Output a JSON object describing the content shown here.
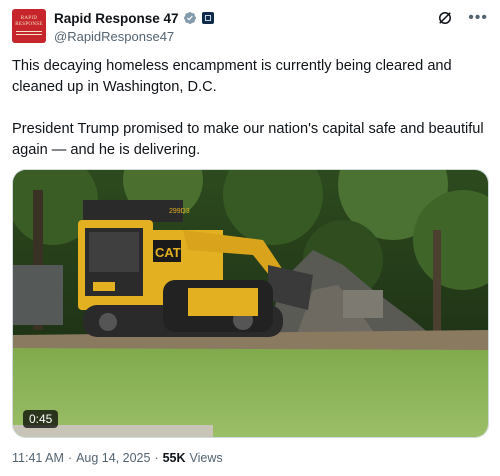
{
  "header": {
    "display_name": "Rapid Response 47",
    "handle": "@RapidResponse47",
    "avatar_text": [
      "RAPID",
      "RESPONSE"
    ],
    "icons": [
      "verified-badge-icon",
      "government-affiliation-icon",
      "grok-icon",
      "more-options-icon"
    ]
  },
  "tweet": {
    "paragraph1": "This decaying homeless encampment is currently being cleared and cleaned up in Washington, D.C.",
    "paragraph2": "President Trump promised to make our nation's capital safe and beautiful again — and he is delivering."
  },
  "media": {
    "duration": "0:45",
    "vehicle_brand": "CAT",
    "vehicle_model": "299D3"
  },
  "meta": {
    "time": "11:41 AM",
    "sep1": "·",
    "date": "Aug 14, 2025",
    "sep2": "·",
    "views_count": "55K",
    "views_label": "Views"
  },
  "colors": {
    "accent_blue": "#1d9bf0",
    "avatar_red": "#c5252b",
    "secondary_text": "#536471",
    "primary_text": "#0f1419"
  }
}
